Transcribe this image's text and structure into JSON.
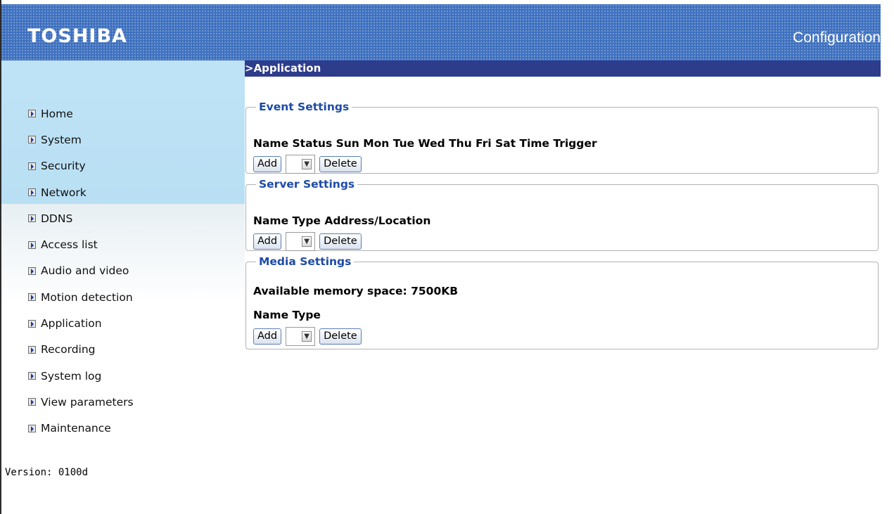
{
  "header": {
    "logo": "TOSHIBA",
    "title": "Configuration"
  },
  "breadcrumb": ">Application",
  "nav": {
    "items": [
      {
        "label": "Home"
      },
      {
        "label": "System"
      },
      {
        "label": "Security"
      },
      {
        "label": "Network"
      },
      {
        "label": "DDNS"
      },
      {
        "label": "Access list"
      },
      {
        "label": "Audio and video"
      },
      {
        "label": "Motion detection"
      },
      {
        "label": "Application"
      },
      {
        "label": "Recording"
      },
      {
        "label": "System log"
      },
      {
        "label": "View parameters"
      },
      {
        "label": "Maintenance"
      }
    ]
  },
  "version": "Version: 0100d",
  "event_settings": {
    "title": "Event Settings",
    "columns": "Name Status Sun Mon Tue Wed Thu Fri Sat Time Trigger",
    "add_label": "Add",
    "delete_label": "Delete"
  },
  "server_settings": {
    "title": "Server Settings",
    "columns": "Name Type Address/Location",
    "add_label": "Add",
    "delete_label": "Delete"
  },
  "media_settings": {
    "title": "Media Settings",
    "memory": "Available memory space: 7500KB",
    "columns": "Name Type",
    "add_label": "Add",
    "delete_label": "Delete"
  },
  "icons": {
    "nav_arrow": "arrow-right-box-icon",
    "dropdown": "chevron-down-icon"
  },
  "colors": {
    "header_bg": "#3f71bf",
    "breadcrumb_bg": "#2e3c8c",
    "sidebar_bg": "#bfe3f6",
    "legend_text": "#1d4ba6"
  }
}
